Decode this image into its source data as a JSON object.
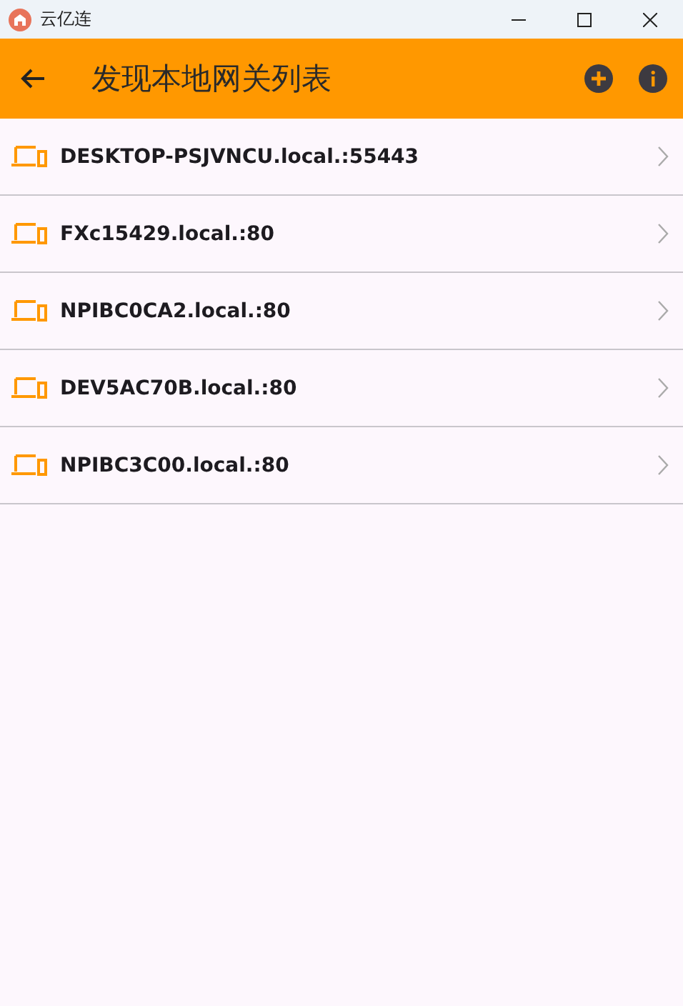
{
  "window": {
    "title": "云亿连"
  },
  "app_bar": {
    "title": "发现本地网关列表"
  },
  "gateways": [
    {
      "name": "DESKTOP-PSJVNCU.local.:55443"
    },
    {
      "name": "FXc15429.local.:80"
    },
    {
      "name": "NPIBC0CA2.local.:80"
    },
    {
      "name": "DEV5AC70B.local.:80"
    },
    {
      "name": "NPIBC3C00.local.:80"
    }
  ]
}
